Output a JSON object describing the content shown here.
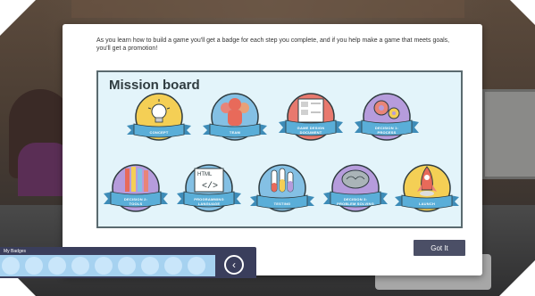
{
  "modal": {
    "intro": "As you learn how to build a game you'll get a badge for each step you complete, and if you help make a game that meets goals, you'll get a promotion!",
    "board_title": "Mission board",
    "got_it_label": "Got It"
  },
  "badges": [
    {
      "label": "CONCEPT",
      "icon": "lightbulb-icon",
      "color": "#f4cf55"
    },
    {
      "label": "TEAM",
      "icon": "people-icon",
      "color": "#e88478"
    },
    {
      "label1": "GAME DESIGN",
      "label2": "DOCUMENT",
      "icon": "document-icon",
      "color": "#e8796e"
    },
    {
      "label1": "DECISION 1:",
      "label2": "PROCESS",
      "icon": "gears-icon",
      "color": "#b69cdc"
    },
    {
      "label1": "DECISION 2:",
      "label2": "TOOLS",
      "icon": "pencils-icon",
      "color": "#b69cdc"
    },
    {
      "label1": "PROGRAMMING",
      "label2": "LANGUAGE",
      "icon": "code-icon",
      "color": "#84c0e4",
      "icon_text_top": "HTML",
      "icon_text_bottom": "</>"
    },
    {
      "label": "TESTING",
      "icon": "flasks-icon",
      "color": "#84c0e4"
    },
    {
      "label1": "DECISION 3:",
      "label2": "PROBLEM SOLVING",
      "icon": "brain-icon",
      "color": "#b69cdc"
    },
    {
      "label": "LAUNCH",
      "icon": "rocket-icon",
      "color": "#f4cf55"
    }
  ],
  "my_badges": {
    "title": "My Badges",
    "slot_count": 9,
    "back_icon": "chevron-left-icon"
  },
  "colors": {
    "ribbon": "#5aaed8",
    "badge_outline": "#2f3c40",
    "button": "#4b4f66",
    "bar": "#3a3e5c"
  }
}
